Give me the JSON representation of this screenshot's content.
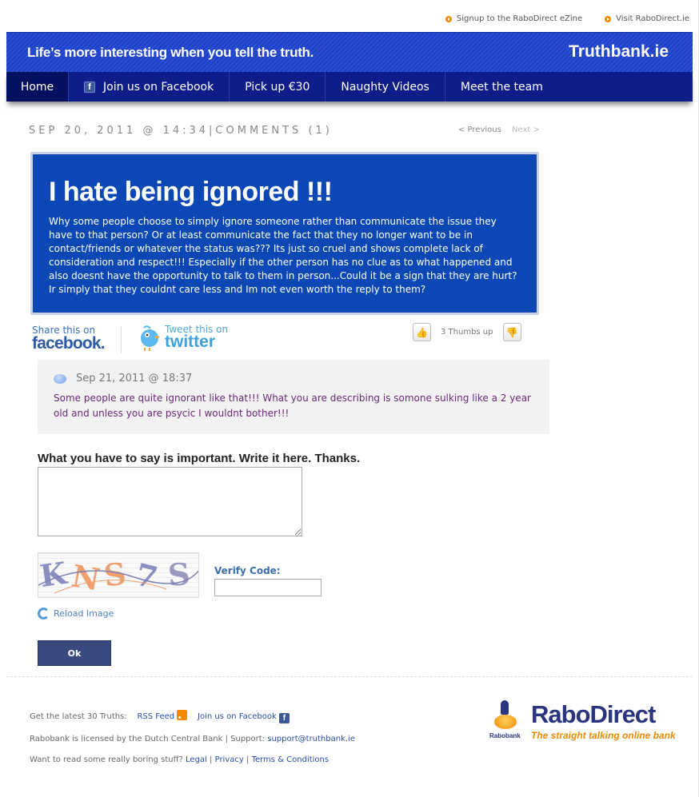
{
  "top_links": {
    "signup": "Signup to the RaboDirect eZine",
    "visit": "Visit RaboDirect.ie"
  },
  "banner": {
    "slogan": "Life’s more interesting when you tell the truth.",
    "brand": "Truthbank.ie"
  },
  "nav": {
    "home": "Home",
    "facebook": "Join us on Facebook",
    "pickup": "Pick up €30",
    "videos": "Naughty Videos",
    "team": "Meet the team"
  },
  "post_meta": {
    "dateline": "SEP 20, 2011 @ 14:34|COMMENTS (1)",
    "previous": "< Previous",
    "next": "Next >"
  },
  "post": {
    "title": "I hate being ignored !!!",
    "body": "Why some people choose to simply ignore someone rather than communicate the issue they have to that person? Or at least communicate the fact that they no longer want to be in contact/friends or whatever the status was??? Its just so cruel and shows complete lack of consideration and respect!!! Especially if the other person has no clue as to what happened and also doesnt have the opportunity to talk to them in person...Could it be a sign that they are hurt? Ir simply that they couldnt care less and Im not even worth the reply to them?"
  },
  "share": {
    "fb_small": "Share this on",
    "fb_big": "facebook.",
    "tw_small": "Tweet this on",
    "tw_big": "twitter",
    "thumbs_count": "3 Thumbs up"
  },
  "comment": {
    "date": "Sep 21, 2011 @ 18:37",
    "text": "Some people are quite ignorant like that!!! What you are describing is somone sulking like a 2 year old and unless you are psycic I wouldnt bother!!!"
  },
  "form": {
    "title": "What you have to say is important. Write it here. Thanks.",
    "captcha": [
      "K",
      "N",
      "S",
      "7",
      "S"
    ],
    "verify_label": "Verify Code:",
    "reload": "Reload Image",
    "ok": "Ok"
  },
  "footer": {
    "latest": "Get the latest 30 Truths:",
    "rss": "RSS Feed",
    "join_fb": "Join us on Facebook",
    "licensed": "Rabobank is licensed by the Dutch Central Bank | Support:",
    "support_email": "support@truthbank.ie",
    "boring": "Want to read some really boring stuff?",
    "legal": "Legal",
    "privacy": "Privacy",
    "terms": "Terms & Conditions",
    "sep": "|"
  },
  "logo": {
    "rabobank": "Rabobank",
    "name": "RaboDirect",
    "tagline": "The straight talking online bank"
  },
  "colors": {
    "banner_blue": "#2a4fd6",
    "nav_blue": "#0f1d8a",
    "post_blue": "#0b48b6",
    "accent_orange": "#f08a00",
    "comment_purple": "#6a2a78"
  }
}
